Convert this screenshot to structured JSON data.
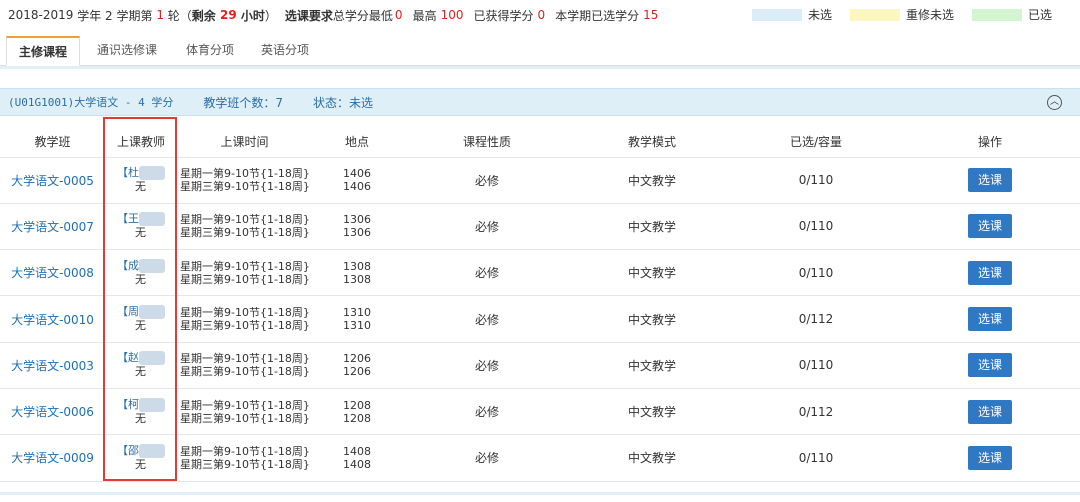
{
  "topbar": {
    "year": "2018-2019",
    "year_suffix": " 学年 2 学期第 ",
    "round": "1",
    "round_suffix": " 轮（",
    "remain_label": "剩余 ",
    "remain_value": "29",
    "remain_unit": " 小时",
    "close_paren": "）",
    "req_label": "选课要求",
    "min_label": "总学分最低",
    "min_value": "0",
    "max_label": "最高",
    "max_value": "100",
    "got_label": "已获得学分",
    "got_value": "0",
    "sem_label": "本学期已选学分",
    "sem_value": "15"
  },
  "legend": [
    {
      "label": "未选",
      "color": "#d9ecf7"
    },
    {
      "label": "重修未选",
      "color": "#fcf6c0"
    },
    {
      "label": "已选",
      "color": "#d3f5cf"
    }
  ],
  "tabs": [
    "主修课程",
    "通识选修课",
    "体育分项",
    "英语分项"
  ],
  "course": {
    "code": "(U01G1001)大学语文 - 4 学分",
    "count_label": "教学班个数：7",
    "status_label": "状态：未选"
  },
  "table": {
    "headers": [
      "教学班",
      "上课教师",
      "上课时间",
      "地点",
      "课程性质",
      "教学模式",
      "已选/容量",
      "操作"
    ],
    "rows": [
      {
        "cls": "大学语文-0005",
        "teacher": "【杜",
        "teacher2": "无",
        "time1": "星期一第9-10节{1-18周}",
        "time2": "星期三第9-10节{1-18周}",
        "p1": "1406",
        "p2": "1406",
        "nature": "必修",
        "mode": "中文教学",
        "cap": "0/110",
        "btn": "选课"
      },
      {
        "cls": "大学语文-0007",
        "teacher": "【王",
        "teacher2": "无",
        "time1": "星期一第9-10节{1-18周}",
        "time2": "星期三第9-10节{1-18周}",
        "p1": "1306",
        "p2": "1306",
        "nature": "必修",
        "mode": "中文教学",
        "cap": "0/110",
        "btn": "选课"
      },
      {
        "cls": "大学语文-0008",
        "teacher": "【成",
        "teacher2": "无",
        "time1": "星期一第9-10节{1-18周}",
        "time2": "星期三第9-10节{1-18周}",
        "p1": "1308",
        "p2": "1308",
        "nature": "必修",
        "mode": "中文教学",
        "cap": "0/110",
        "btn": "选课"
      },
      {
        "cls": "大学语文-0010",
        "teacher": "【周",
        "teacher2": "无",
        "time1": "星期一第9-10节{1-18周}",
        "time2": "星期三第9-10节{1-18周}",
        "p1": "1310",
        "p2": "1310",
        "nature": "必修",
        "mode": "中文教学",
        "cap": "0/112",
        "btn": "选课"
      },
      {
        "cls": "大学语文-0003",
        "teacher": "【赵",
        "teacher2": "无",
        "time1": "星期一第9-10节{1-18周}",
        "time2": "星期三第9-10节{1-18周}",
        "p1": "1206",
        "p2": "1206",
        "nature": "必修",
        "mode": "中文教学",
        "cap": "0/110",
        "btn": "选课"
      },
      {
        "cls": "大学语文-0006",
        "teacher": "【柯",
        "teacher2": "无",
        "time1": "星期一第9-10节{1-18周}",
        "time2": "星期三第9-10节{1-18周}",
        "p1": "1208",
        "p2": "1208",
        "nature": "必修",
        "mode": "中文教学",
        "cap": "0/112",
        "btn": "选课"
      },
      {
        "cls": "大学语文-0009",
        "teacher": "【邵",
        "teacher2": "无",
        "time1": "星期一第9-10节{1-18周}",
        "time2": "星期三第9-10节{1-18周}",
        "p1": "1408",
        "p2": "1408",
        "nature": "必修",
        "mode": "中文教学",
        "cap": "0/110",
        "btn": "选课"
      }
    ]
  }
}
